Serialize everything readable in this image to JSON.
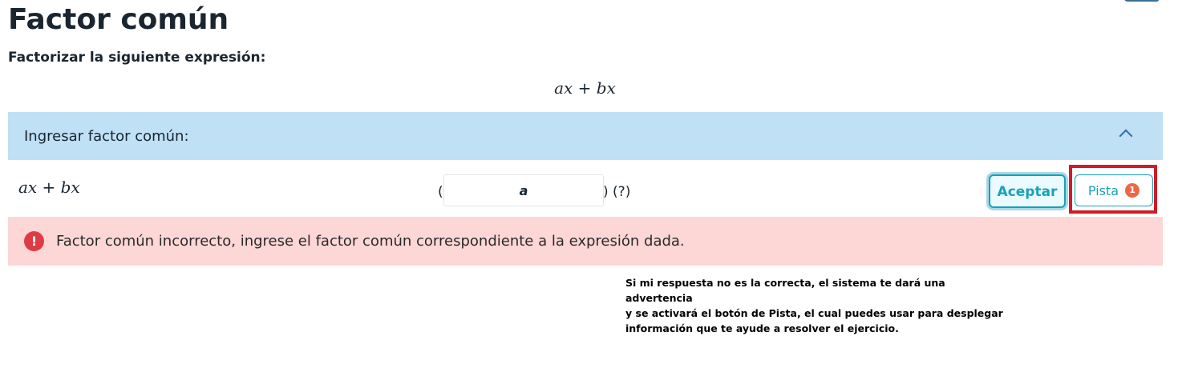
{
  "page": {
    "title": "Factor común",
    "instruction": "Factorizar la siguiente expresión:",
    "expression": "ax + bx"
  },
  "accordion": {
    "label": "Ingresar factor común:",
    "icon": "chevron-up-icon"
  },
  "answer_row": {
    "expression": "ax + bx",
    "open_paren": "(",
    "input_value": "a",
    "close_paren": ") (?)",
    "accept_label": "Aceptar",
    "hint_label": "Pista",
    "hint_count": "1"
  },
  "alert": {
    "icon": "exclamation-circle-icon",
    "message": "Factor común incorrecto, ingrese el factor común correspondiente a la expresión dada."
  },
  "annotation": {
    "text": "Si mi respuesta no es la correcta, el sistema te dará una advertencia\ny se activará el botón de Pista, el cual puedes usar para desplegar\ninformación que te ayude a resolver el ejercicio."
  },
  "colors": {
    "accordion_bg": "#bfe0f5",
    "alert_bg": "#fdd6d6",
    "alert_icon": "#dd3c44",
    "button_accent": "#17a2b8",
    "highlight": "#d01c28",
    "badge": "#ee6644"
  }
}
